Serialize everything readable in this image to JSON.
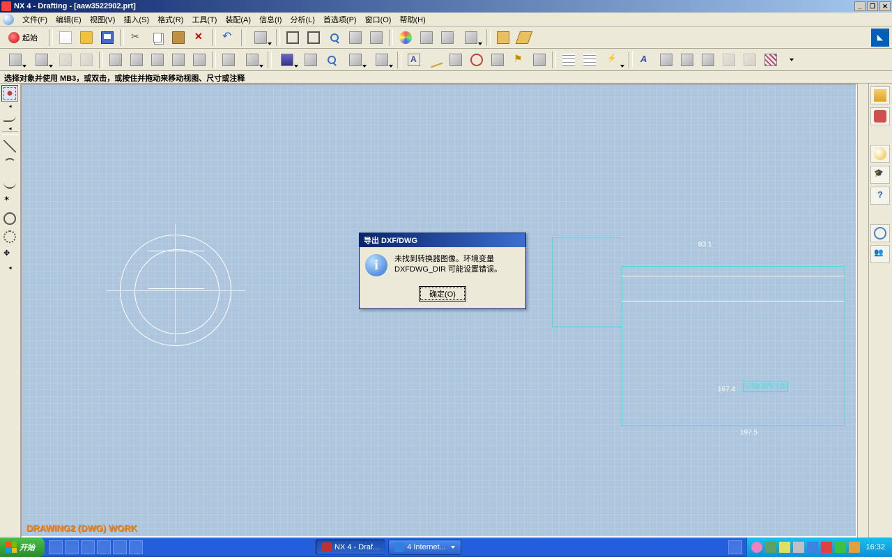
{
  "titlebar": {
    "text": "NX 4 - Drafting - [aaw3522902.prt]"
  },
  "menu": {
    "items": [
      "文件(F)",
      "编辑(E)",
      "视图(V)",
      "插入(S)",
      "格式(R)",
      "工具(T)",
      "装配(A)",
      "信息(I)",
      "分析(L)",
      "首选项(P)",
      "窗口(O)",
      "帮助(H)"
    ]
  },
  "toolbar1": {
    "start": "起始"
  },
  "hint": "选择对象并使用 MB3，或双击，或按住并拖动来移动视图、尺寸或注释",
  "drawing": {
    "label": "DRAWING2 (DWG) WORK",
    "dims": {
      "d1": "83.1",
      "d2": "167.4",
      "d3": "197.5",
      "box": "▵ 50.075 ▯ 0"
    }
  },
  "dialog": {
    "title": "导出 DXF/DWG",
    "line1": "未找到转换器图像。环境变量",
    "line2": "DXFDWG_DIR 可能设置错误。",
    "ok": "确定(O)"
  },
  "taskbar": {
    "start": "开始",
    "task1": "NX 4 - Draf...",
    "task2": "4 Internet...",
    "clock": "16:32"
  }
}
